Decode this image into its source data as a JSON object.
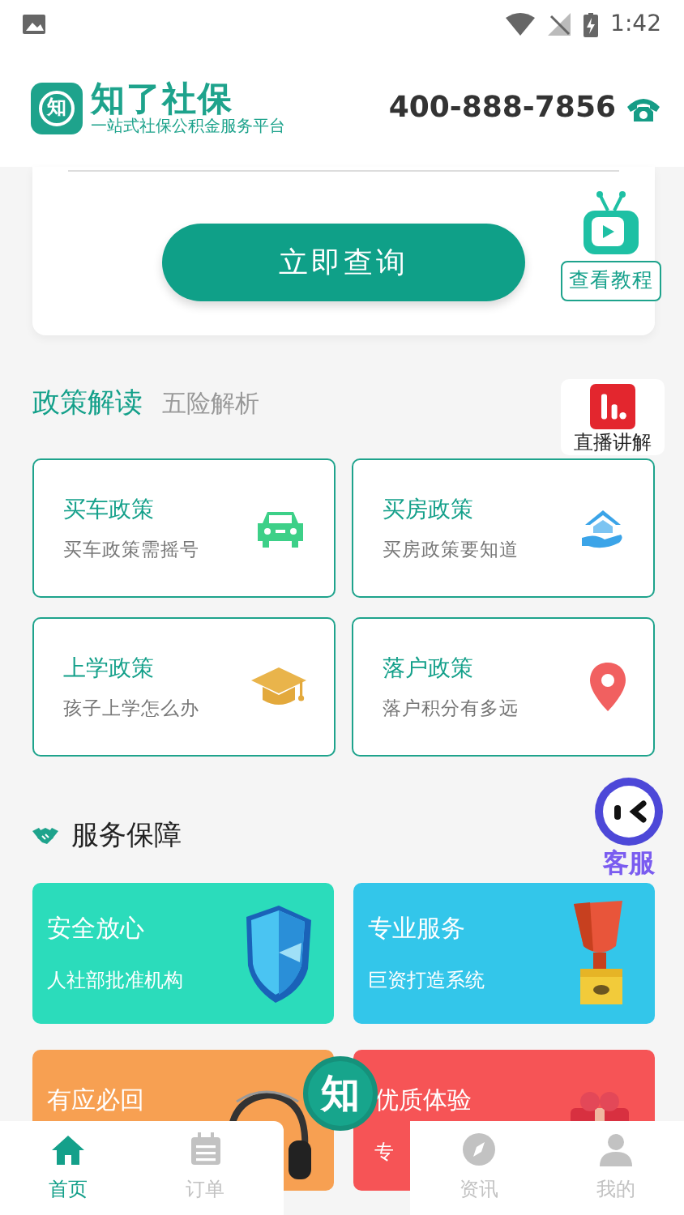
{
  "status_bar": {
    "time": "1:42"
  },
  "header": {
    "logo_mark": "知",
    "brand": "知了社保",
    "slogan": "一站式社保公积金服务平台",
    "phone": "400-888-7856"
  },
  "query": {
    "button": "立即查询"
  },
  "tutorial": {
    "label": "查看教程"
  },
  "policy": {
    "tabs": [
      {
        "label": "政策解读",
        "selected": true
      },
      {
        "label": "五险解析",
        "selected": false
      }
    ],
    "items": [
      {
        "kind": "car",
        "title": "买车政策",
        "subtitle": "买车政策需摇号"
      },
      {
        "kind": "house",
        "title": "买房政策",
        "subtitle": "买房政策要知道"
      },
      {
        "kind": "school",
        "title": "上学政策",
        "subtitle": "孩子上学怎么办"
      },
      {
        "kind": "residence",
        "title": "落户政策",
        "subtitle": "落户积分有多远"
      }
    ]
  },
  "live": {
    "label": "直播讲解"
  },
  "service": {
    "title": "服务保障",
    "cards": [
      {
        "kind": "shield",
        "title": "安全放心",
        "subtitle": "人社部批准机构",
        "color": "#2bdcbb"
      },
      {
        "kind": "trophy",
        "title": "专业服务",
        "subtitle": "巨资打造系统",
        "color": "#33c6ea"
      },
      {
        "kind": "headphones",
        "title": "有应必回",
        "color": "#f7a052"
      },
      {
        "kind": "gift",
        "title": "优质体验",
        "subtitle": "专",
        "color": "#f65456"
      }
    ]
  },
  "support": {
    "label": "客服"
  },
  "nav": {
    "center": "知",
    "items": [
      {
        "kind": "home",
        "label": "首页",
        "selected": true
      },
      {
        "kind": "orders",
        "label": "订单",
        "selected": false
      },
      {
        "kind": "news",
        "label": "资讯",
        "selected": false
      },
      {
        "kind": "profile",
        "label": "我的",
        "selected": false
      }
    ]
  }
}
